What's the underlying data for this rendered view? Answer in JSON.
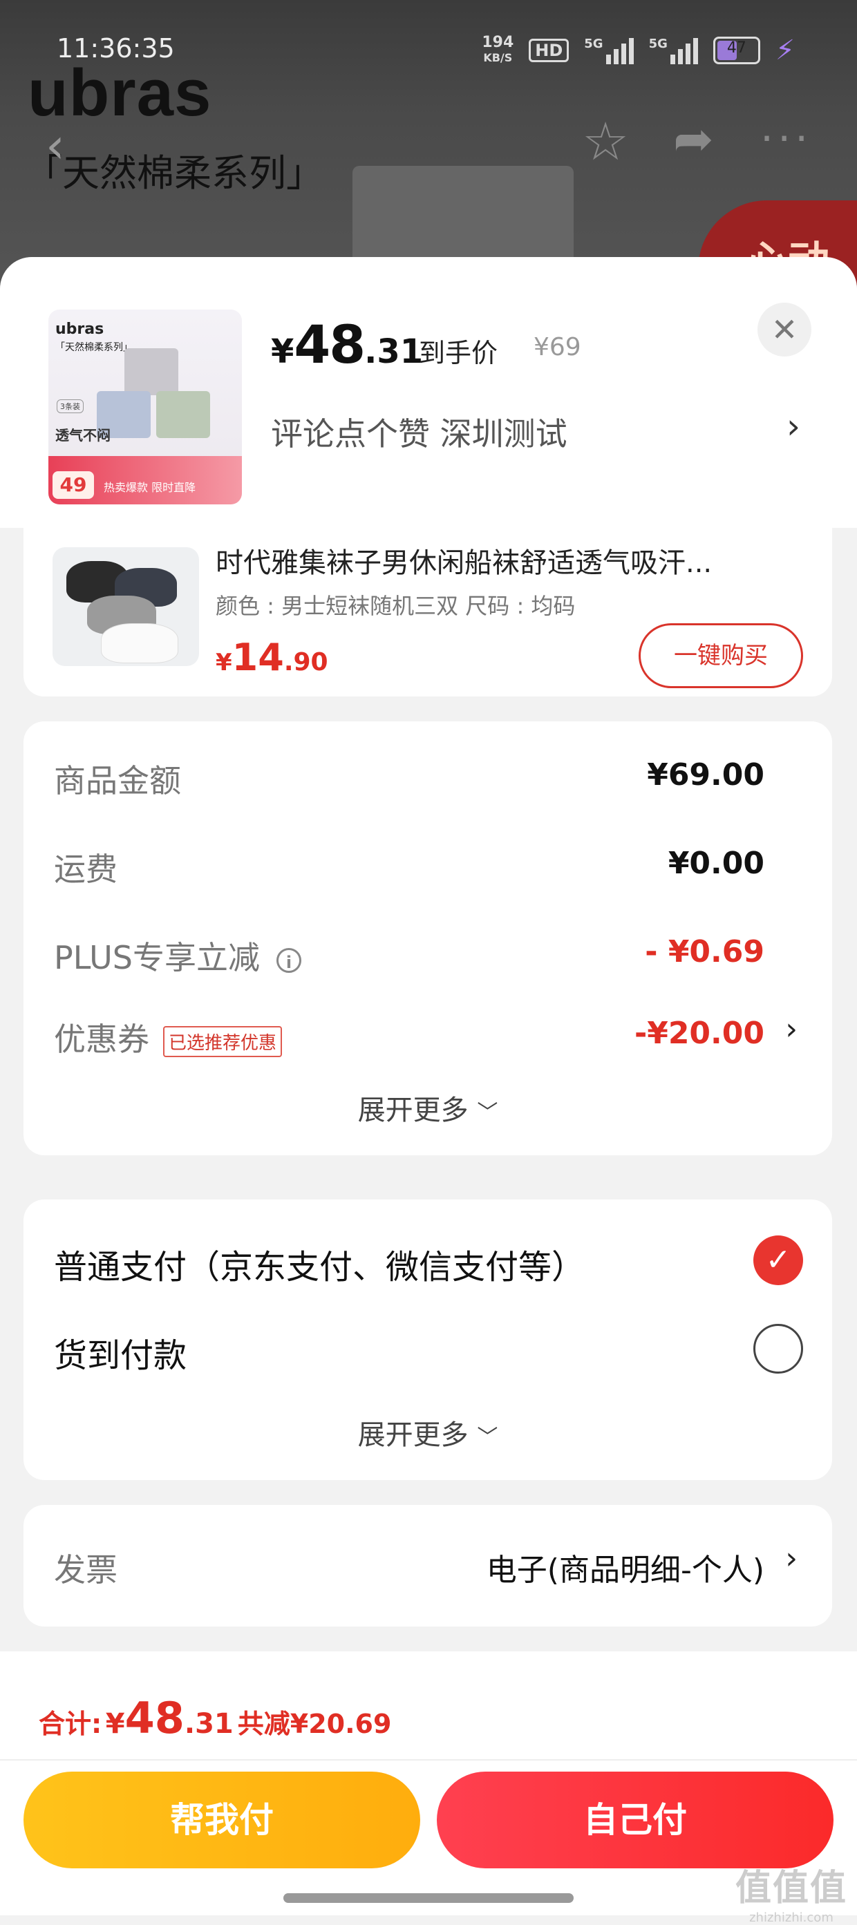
{
  "status_bar": {
    "time": "11:36:35",
    "net_speed_value": "194",
    "net_speed_unit": "KB/S",
    "hd_label": "HD",
    "sim1_label": "5G",
    "sim2_label": "5G",
    "battery_level": "47",
    "icons": [
      "hd-icon",
      "signal-icon",
      "battery-icon",
      "charging-bolt-icon"
    ]
  },
  "background_page": {
    "brand_logo": "ubras",
    "series": "「天然棉柔系列」",
    "promo_text": "心动",
    "nav_icons": [
      "back-icon",
      "star-icon",
      "share-icon",
      "more-icon"
    ]
  },
  "product_header": {
    "thumbnail": {
      "brand": "ubras",
      "series": "「天然棉柔系列」",
      "pack": "3条装",
      "claim": "透气不闷",
      "price_badge": "49",
      "tag": "热卖爆款 限时直降",
      "swatch_colors": [
        "#c9c7cd",
        "#b7c2d8",
        "#bcc9b6"
      ]
    },
    "price_currency": "¥",
    "price_integer": "48",
    "price_decimal": ".31",
    "price_type_label": "到手价",
    "original_price": "¥69",
    "spec_text": "评论点个赞  深圳测试",
    "close_icon": "close-icon"
  },
  "addon_item": {
    "title": "时代雅集袜子男休闲船袜舒适透气吸汗...",
    "spec": "颜色 : 男士短袜随机三双    尺码 : 均码",
    "price_currency": "¥",
    "price_integer": "14",
    "price_decimal": ".90",
    "buy_label": "一键购买"
  },
  "amount_section": {
    "rows": [
      {
        "label": "商品金额",
        "value": "¥69.00"
      },
      {
        "label": "运费",
        "value": "¥0.00"
      },
      {
        "label": "PLUS专享立减",
        "value": "- ¥0.69"
      },
      {
        "label": "优惠券",
        "tag": "已选推荐优惠",
        "value": "-¥20.00"
      }
    ],
    "expand_label": "展开更多"
  },
  "payment_section": {
    "options": [
      {
        "label": "普通支付（京东支付、微信支付等）",
        "selected": true
      },
      {
        "label": "货到付款",
        "selected": false
      }
    ],
    "expand_label": "展开更多"
  },
  "invoice": {
    "label": "发票",
    "value": "电子(商品明细-个人)"
  },
  "bottom_bar": {
    "total_label": "合计:",
    "total_currency": "¥",
    "total_integer": "48",
    "total_decimal": ".31",
    "savings": "共减¥20.69",
    "help_pay_label": "帮我付",
    "self_pay_label": "自己付"
  },
  "watermark": {
    "logo": "值值值",
    "site": "zhizhizhi.com"
  },
  "colors": {
    "accent_red": "#e02e24",
    "help_button": "#ffb612",
    "self_button": "#fb3540"
  }
}
